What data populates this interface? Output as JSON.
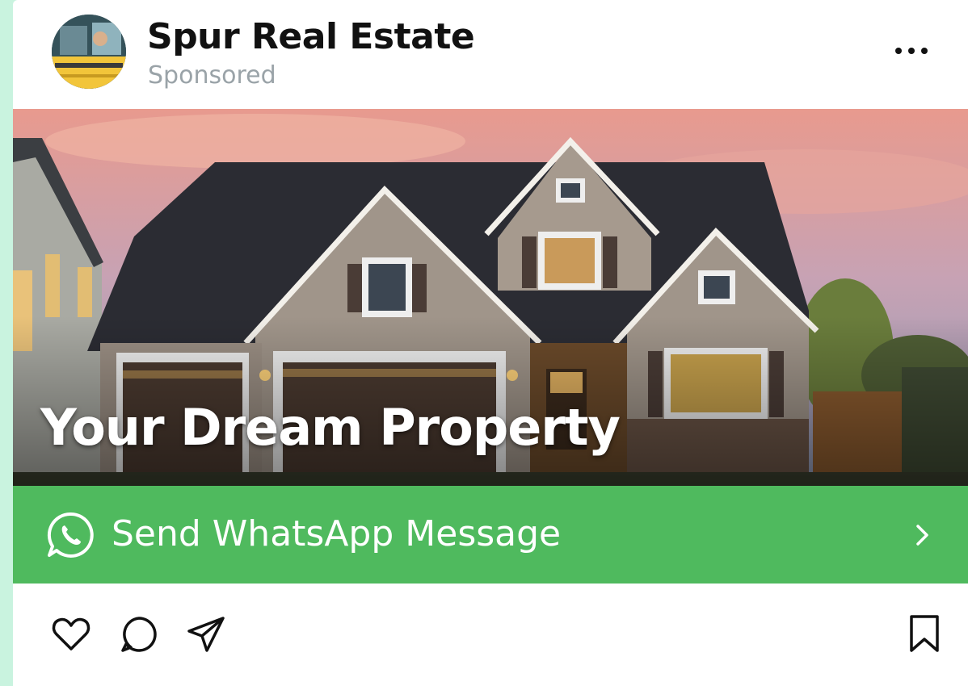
{
  "post": {
    "brand_name": "Spur Real Estate",
    "sponsored_label": "Sponsored",
    "headline": "Your Dream Property",
    "cta_label": "Send WhatsApp Message"
  },
  "icons": {
    "more": "more-horizontal-icon",
    "whatsapp": "whatsapp-icon",
    "chevron": "chevron-right-icon",
    "like": "heart-icon",
    "comment": "comment-icon",
    "share": "send-icon",
    "save": "bookmark-icon"
  },
  "colors": {
    "cta_background": "#4fba5e",
    "page_accent": "#c9f3df",
    "text_primary": "#111111",
    "text_secondary": "#9aa3a8"
  }
}
